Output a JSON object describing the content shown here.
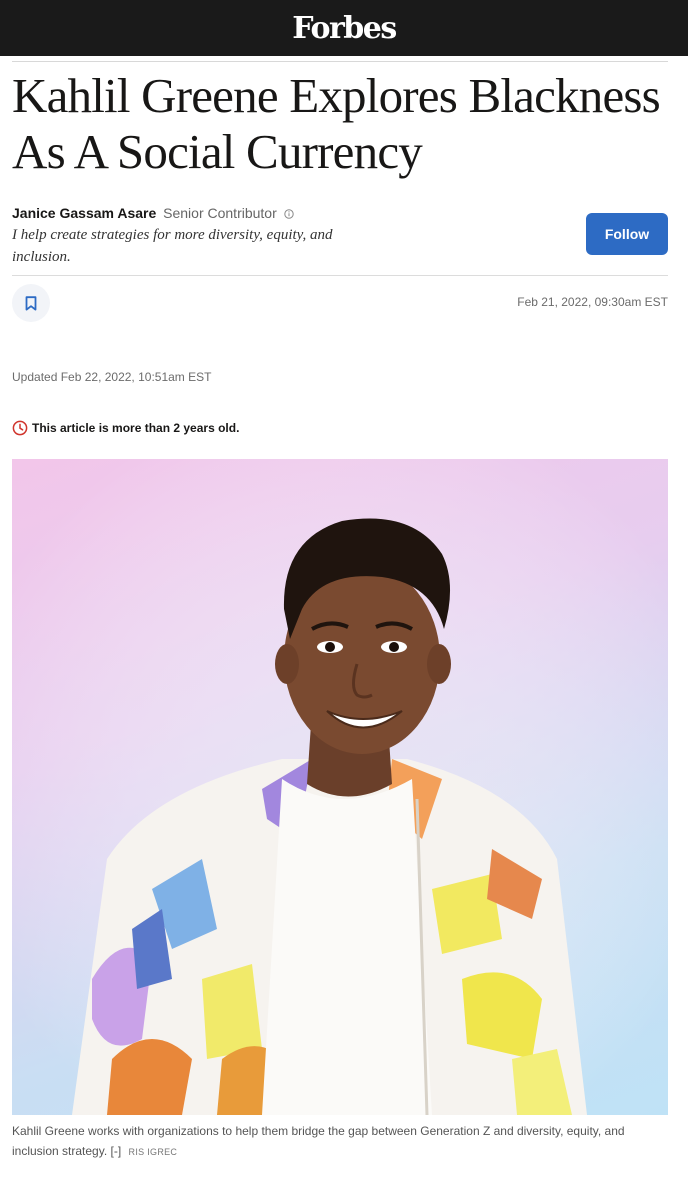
{
  "header": {
    "logo_text": "Forbes"
  },
  "article": {
    "title": "Kahlil Greene Explores Blackness As A Social Currency",
    "author": {
      "name": "Janice Gassam Asare",
      "role": "Senior Contributor",
      "bio": "I help create strategies for more diversity, equity, and inclusion."
    },
    "follow_label": "Follow",
    "published": "Feb 21, 2022, 09:30am EST",
    "updated": "Updated Feb 22, 2022, 10:51am EST",
    "age_notice": "This article is more than 2 years old.",
    "image_caption": "Kahlil Greene works with organizations to help them bridge the gap between Generation Z and diversity, equity, and inclusion strategy.",
    "caption_toggle": "[-]",
    "image_credit": "RIS IGREC"
  },
  "colors": {
    "topbar": "#1a1a1a",
    "follow_button": "#2d6bc4",
    "alert_icon": "#d0342c",
    "bookmark_icon": "#2d6bc4"
  },
  "icons": {
    "info": "info-icon",
    "bookmark": "bookmark-icon",
    "clock": "clock-icon"
  }
}
